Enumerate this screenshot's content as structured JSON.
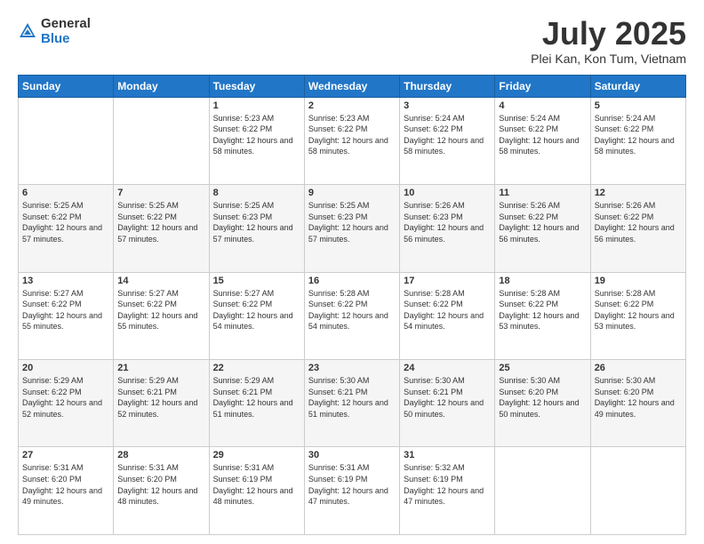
{
  "header": {
    "logo_general": "General",
    "logo_blue": "Blue",
    "month": "July 2025",
    "location": "Plei Kan, Kon Tum, Vietnam"
  },
  "days_of_week": [
    "Sunday",
    "Monday",
    "Tuesday",
    "Wednesday",
    "Thursday",
    "Friday",
    "Saturday"
  ],
  "weeks": [
    [
      {
        "day": "",
        "sunrise": "",
        "sunset": "",
        "daylight": ""
      },
      {
        "day": "",
        "sunrise": "",
        "sunset": "",
        "daylight": ""
      },
      {
        "day": "1",
        "sunrise": "Sunrise: 5:23 AM",
        "sunset": "Sunset: 6:22 PM",
        "daylight": "Daylight: 12 hours and 58 minutes."
      },
      {
        "day": "2",
        "sunrise": "Sunrise: 5:23 AM",
        "sunset": "Sunset: 6:22 PM",
        "daylight": "Daylight: 12 hours and 58 minutes."
      },
      {
        "day": "3",
        "sunrise": "Sunrise: 5:24 AM",
        "sunset": "Sunset: 6:22 PM",
        "daylight": "Daylight: 12 hours and 58 minutes."
      },
      {
        "day": "4",
        "sunrise": "Sunrise: 5:24 AM",
        "sunset": "Sunset: 6:22 PM",
        "daylight": "Daylight: 12 hours and 58 minutes."
      },
      {
        "day": "5",
        "sunrise": "Sunrise: 5:24 AM",
        "sunset": "Sunset: 6:22 PM",
        "daylight": "Daylight: 12 hours and 58 minutes."
      }
    ],
    [
      {
        "day": "6",
        "sunrise": "Sunrise: 5:25 AM",
        "sunset": "Sunset: 6:22 PM",
        "daylight": "Daylight: 12 hours and 57 minutes."
      },
      {
        "day": "7",
        "sunrise": "Sunrise: 5:25 AM",
        "sunset": "Sunset: 6:22 PM",
        "daylight": "Daylight: 12 hours and 57 minutes."
      },
      {
        "day": "8",
        "sunrise": "Sunrise: 5:25 AM",
        "sunset": "Sunset: 6:23 PM",
        "daylight": "Daylight: 12 hours and 57 minutes."
      },
      {
        "day": "9",
        "sunrise": "Sunrise: 5:25 AM",
        "sunset": "Sunset: 6:23 PM",
        "daylight": "Daylight: 12 hours and 57 minutes."
      },
      {
        "day": "10",
        "sunrise": "Sunrise: 5:26 AM",
        "sunset": "Sunset: 6:23 PM",
        "daylight": "Daylight: 12 hours and 56 minutes."
      },
      {
        "day": "11",
        "sunrise": "Sunrise: 5:26 AM",
        "sunset": "Sunset: 6:22 PM",
        "daylight": "Daylight: 12 hours and 56 minutes."
      },
      {
        "day": "12",
        "sunrise": "Sunrise: 5:26 AM",
        "sunset": "Sunset: 6:22 PM",
        "daylight": "Daylight: 12 hours and 56 minutes."
      }
    ],
    [
      {
        "day": "13",
        "sunrise": "Sunrise: 5:27 AM",
        "sunset": "Sunset: 6:22 PM",
        "daylight": "Daylight: 12 hours and 55 minutes."
      },
      {
        "day": "14",
        "sunrise": "Sunrise: 5:27 AM",
        "sunset": "Sunset: 6:22 PM",
        "daylight": "Daylight: 12 hours and 55 minutes."
      },
      {
        "day": "15",
        "sunrise": "Sunrise: 5:27 AM",
        "sunset": "Sunset: 6:22 PM",
        "daylight": "Daylight: 12 hours and 54 minutes."
      },
      {
        "day": "16",
        "sunrise": "Sunrise: 5:28 AM",
        "sunset": "Sunset: 6:22 PM",
        "daylight": "Daylight: 12 hours and 54 minutes."
      },
      {
        "day": "17",
        "sunrise": "Sunrise: 5:28 AM",
        "sunset": "Sunset: 6:22 PM",
        "daylight": "Daylight: 12 hours and 54 minutes."
      },
      {
        "day": "18",
        "sunrise": "Sunrise: 5:28 AM",
        "sunset": "Sunset: 6:22 PM",
        "daylight": "Daylight: 12 hours and 53 minutes."
      },
      {
        "day": "19",
        "sunrise": "Sunrise: 5:28 AM",
        "sunset": "Sunset: 6:22 PM",
        "daylight": "Daylight: 12 hours and 53 minutes."
      }
    ],
    [
      {
        "day": "20",
        "sunrise": "Sunrise: 5:29 AM",
        "sunset": "Sunset: 6:22 PM",
        "daylight": "Daylight: 12 hours and 52 minutes."
      },
      {
        "day": "21",
        "sunrise": "Sunrise: 5:29 AM",
        "sunset": "Sunset: 6:21 PM",
        "daylight": "Daylight: 12 hours and 52 minutes."
      },
      {
        "day": "22",
        "sunrise": "Sunrise: 5:29 AM",
        "sunset": "Sunset: 6:21 PM",
        "daylight": "Daylight: 12 hours and 51 minutes."
      },
      {
        "day": "23",
        "sunrise": "Sunrise: 5:30 AM",
        "sunset": "Sunset: 6:21 PM",
        "daylight": "Daylight: 12 hours and 51 minutes."
      },
      {
        "day": "24",
        "sunrise": "Sunrise: 5:30 AM",
        "sunset": "Sunset: 6:21 PM",
        "daylight": "Daylight: 12 hours and 50 minutes."
      },
      {
        "day": "25",
        "sunrise": "Sunrise: 5:30 AM",
        "sunset": "Sunset: 6:20 PM",
        "daylight": "Daylight: 12 hours and 50 minutes."
      },
      {
        "day": "26",
        "sunrise": "Sunrise: 5:30 AM",
        "sunset": "Sunset: 6:20 PM",
        "daylight": "Daylight: 12 hours and 49 minutes."
      }
    ],
    [
      {
        "day": "27",
        "sunrise": "Sunrise: 5:31 AM",
        "sunset": "Sunset: 6:20 PM",
        "daylight": "Daylight: 12 hours and 49 minutes."
      },
      {
        "day": "28",
        "sunrise": "Sunrise: 5:31 AM",
        "sunset": "Sunset: 6:20 PM",
        "daylight": "Daylight: 12 hours and 48 minutes."
      },
      {
        "day": "29",
        "sunrise": "Sunrise: 5:31 AM",
        "sunset": "Sunset: 6:19 PM",
        "daylight": "Daylight: 12 hours and 48 minutes."
      },
      {
        "day": "30",
        "sunrise": "Sunrise: 5:31 AM",
        "sunset": "Sunset: 6:19 PM",
        "daylight": "Daylight: 12 hours and 47 minutes."
      },
      {
        "day": "31",
        "sunrise": "Sunrise: 5:32 AM",
        "sunset": "Sunset: 6:19 PM",
        "daylight": "Daylight: 12 hours and 47 minutes."
      },
      {
        "day": "",
        "sunrise": "",
        "sunset": "",
        "daylight": ""
      },
      {
        "day": "",
        "sunrise": "",
        "sunset": "",
        "daylight": ""
      }
    ]
  ]
}
